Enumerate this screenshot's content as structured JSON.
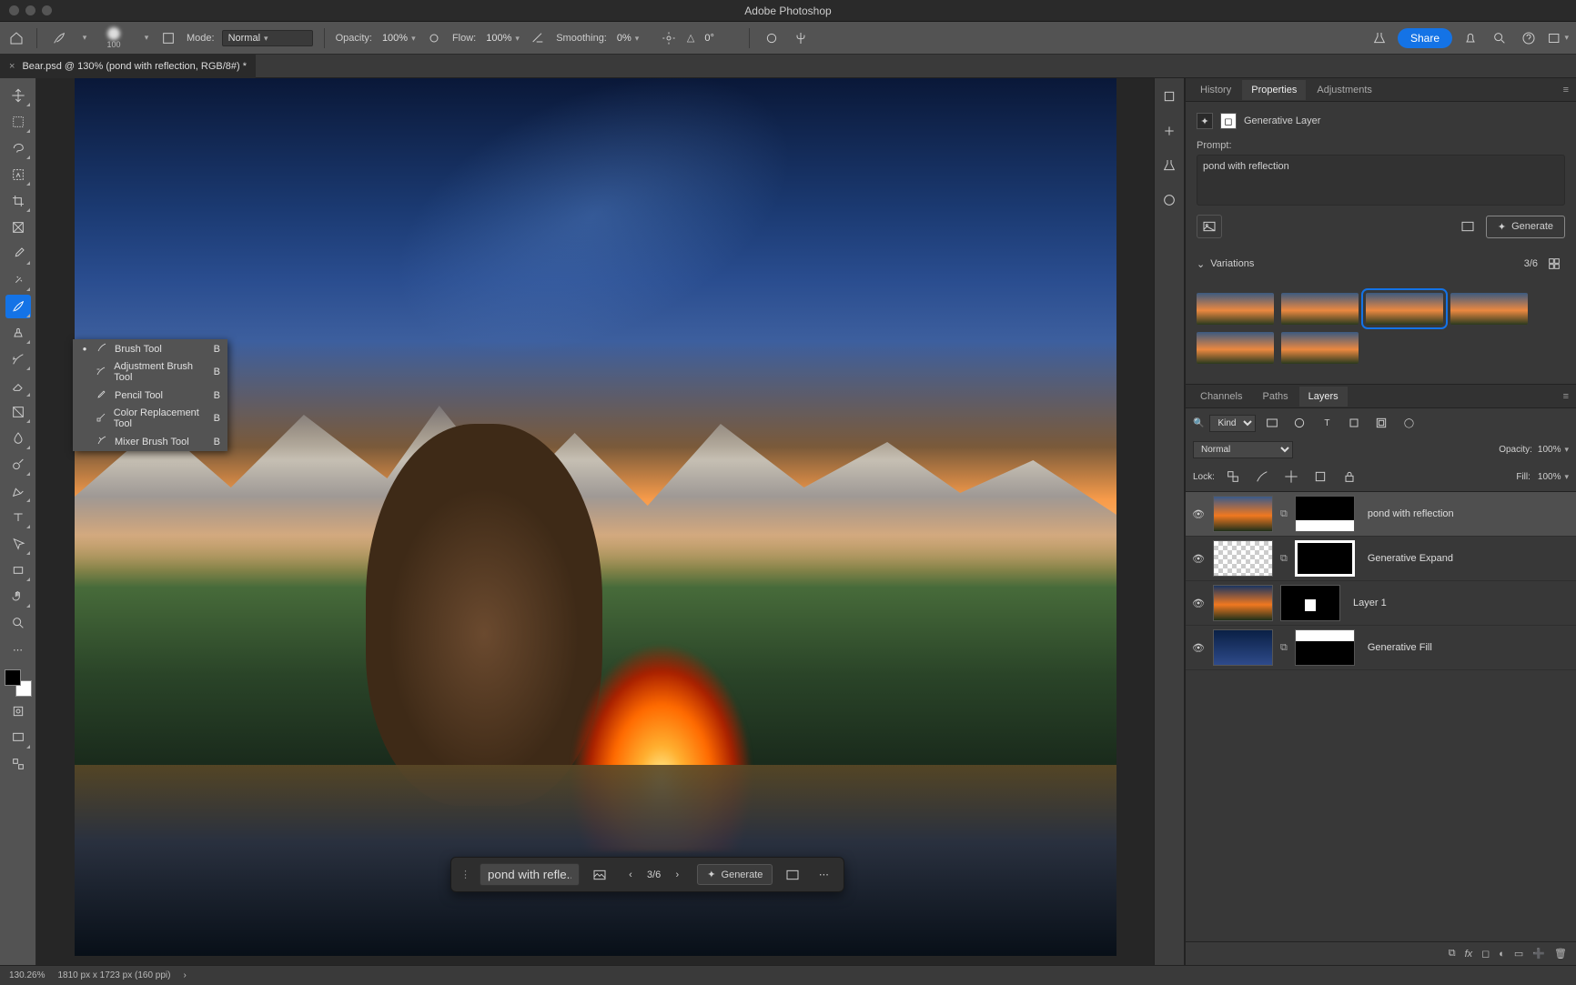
{
  "app_title": "Adobe Photoshop",
  "document_tab": "Bear.psd @ 130% (pond with reflection, RGB/8#) *",
  "options_bar": {
    "brush_size": "100",
    "mode_label": "Mode:",
    "mode_value": "Normal",
    "opacity_label": "Opacity:",
    "opacity_value": "100%",
    "flow_label": "Flow:",
    "flow_value": "100%",
    "smoothing_label": "Smoothing:",
    "smoothing_value": "0%",
    "angle_label": "△",
    "angle_value": "0°",
    "share": "Share"
  },
  "tool_flyout": [
    {
      "dot": "●",
      "label": "Brush Tool",
      "key": "B"
    },
    {
      "dot": "",
      "label": "Adjustment Brush Tool",
      "key": "B"
    },
    {
      "dot": "",
      "label": "Pencil Tool",
      "key": "B"
    },
    {
      "dot": "",
      "label": "Color Replacement Tool",
      "key": "B"
    },
    {
      "dot": "",
      "label": "Mixer Brush Tool",
      "key": "B"
    }
  ],
  "context_bar": {
    "prompt_truncated": "pond with refle...",
    "counter": "3/6",
    "generate": "Generate"
  },
  "panel_tabs_top": {
    "history": "History",
    "properties": "Properties",
    "adjustments": "Adjustments"
  },
  "properties": {
    "layer_type": "Generative Layer",
    "prompt_label": "Prompt:",
    "prompt_value": "pond with reflection",
    "generate": "Generate",
    "variations_label": "Variations",
    "variations_counter": "3/6"
  },
  "panel_tabs_bottom": {
    "channels": "Channels",
    "paths": "Paths",
    "layers": "Layers"
  },
  "layers_opts": {
    "filter_label": "Kind",
    "blend_mode": "Normal",
    "opacity_label": "Opacity:",
    "opacity_value": "100%",
    "lock_label": "Lock:",
    "fill_label": "Fill:",
    "fill_value": "100%"
  },
  "layers": [
    {
      "name": "pond with reflection",
      "selected": true
    },
    {
      "name": "Generative Expand",
      "selected": false
    },
    {
      "name": "Layer 1",
      "selected": false
    },
    {
      "name": "Generative Fill",
      "selected": false
    }
  ],
  "statusbar": {
    "zoom": "130.26%",
    "dims": "1810 px x 1723 px (160 ppi)"
  }
}
